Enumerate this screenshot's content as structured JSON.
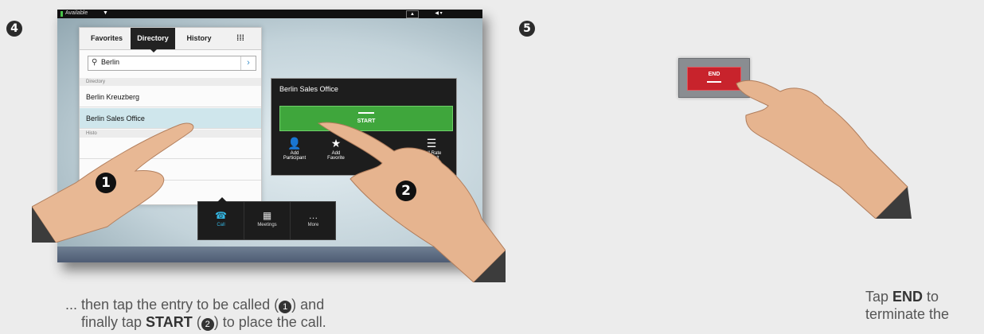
{
  "step4": {
    "badge": "4"
  },
  "step5": {
    "badge": "5"
  },
  "statusbar": {
    "availability": "Available"
  },
  "directory": {
    "tabs": [
      "Favorites",
      "Directory",
      "History"
    ],
    "search_value": "Berlin",
    "section_directory": "Directory",
    "section_history": "Histo",
    "entries": [
      "Berlin Kreuzberg",
      "Berlin Sales Office"
    ]
  },
  "detail": {
    "title": "Berlin Sales Office",
    "start_label": "START",
    "actions": [
      {
        "line1": "Add",
        "line2": "Participant",
        "icon": "add-participant-icon"
      },
      {
        "line1": "Add",
        "line2": "Favorite",
        "icon": "star-icon"
      },
      {
        "line1": "",
        "line2": "",
        "icon": "blank"
      },
      {
        "line1": "Call Rate",
        "line2": "Default",
        "icon": "list-icon"
      }
    ]
  },
  "dock": {
    "items": [
      "Call",
      "Meetings",
      "More"
    ]
  },
  "callouts": {
    "one": "1",
    "two": "2"
  },
  "end_button": {
    "label": "END"
  },
  "caption_left": {
    "line1_prefix": "... then tap the entry to be called (",
    "line1_mark": "1",
    "line1_suffix": ") and",
    "line2_prefix": "finally tap ",
    "line2_bold": "START",
    "line2_mid": " (",
    "line2_mark": "2",
    "line2_suffix": ")  to place the call."
  },
  "caption_right": {
    "line1_prefix": "Tap ",
    "line1_bold": "END",
    "line1_suffix": " to",
    "line2": "terminate the"
  },
  "colors": {
    "start_green": "#3fa63c",
    "end_red": "#c8232c",
    "accent_cyan": "#34b6e2"
  }
}
